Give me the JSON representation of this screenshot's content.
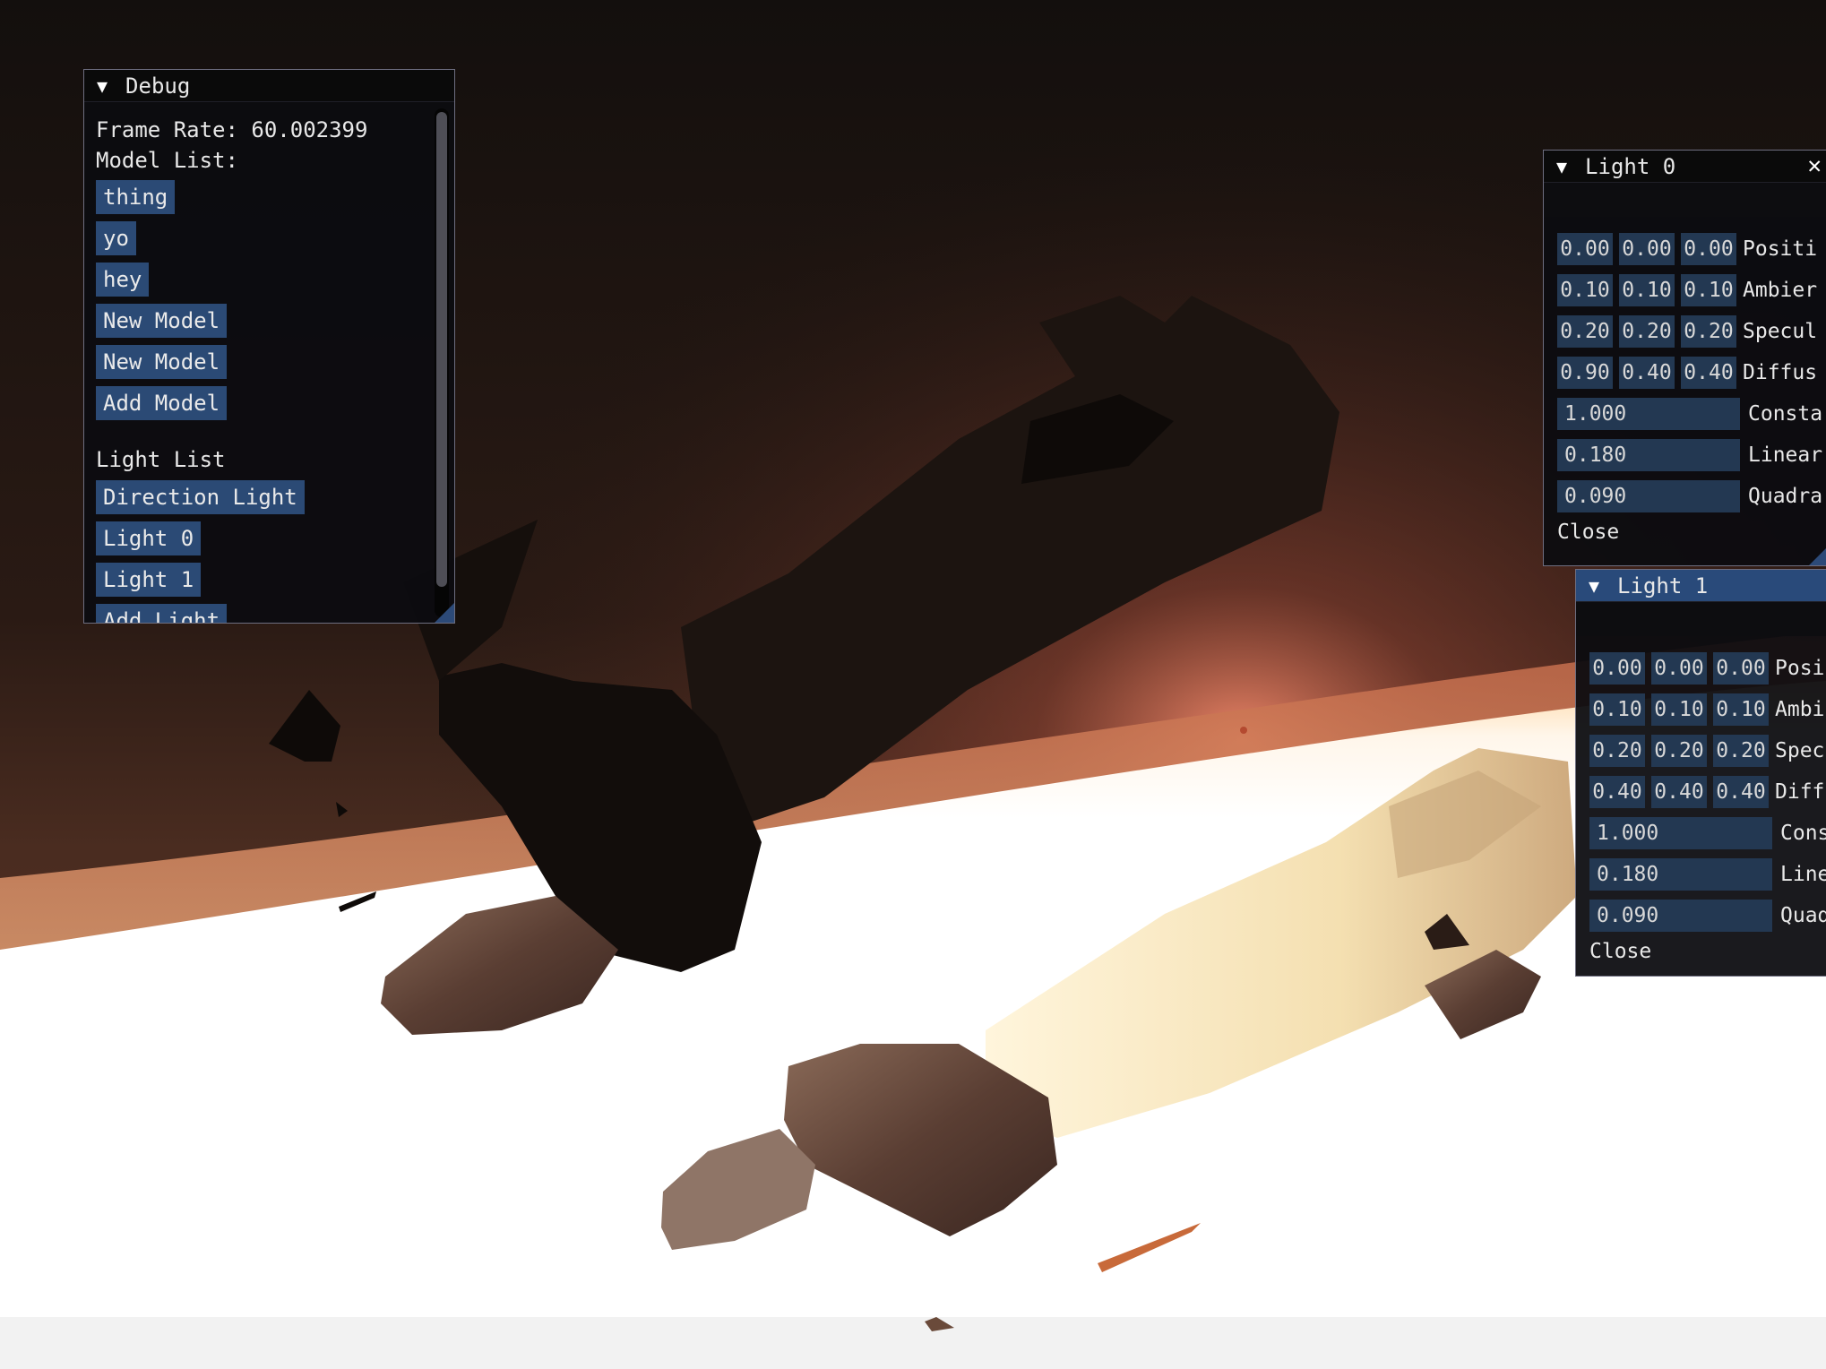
{
  "debug": {
    "title": "Debug",
    "frame_rate": "Frame Rate: 60.002399",
    "model_list_label": "Model List:",
    "models": [
      "thing",
      "yo",
      "hey",
      "New Model",
      "New Model",
      "Add Model"
    ],
    "light_list_label": "Light List",
    "lights": [
      "Direction Light",
      "Light 0",
      "Light 1",
      "Add Light"
    ]
  },
  "light0": {
    "title": "Light 0",
    "close_symbol": "✕",
    "rows": [
      {
        "values": [
          "0.00",
          "0.00",
          "0.00"
        ],
        "label": "Positi"
      },
      {
        "values": [
          "0.10",
          "0.10",
          "0.10"
        ],
        "label": "Ambier"
      },
      {
        "values": [
          "0.20",
          "0.20",
          "0.20"
        ],
        "label": "Specul"
      },
      {
        "values": [
          "0.90",
          "0.40",
          "0.40"
        ],
        "label": "Diffus"
      }
    ],
    "scalars": [
      {
        "value": "1.000",
        "label": "Consta"
      },
      {
        "value": "0.180",
        "label": "Linear"
      },
      {
        "value": "0.090",
        "label": "Quadra"
      }
    ],
    "close_label": "Close"
  },
  "light1": {
    "title": "Light 1",
    "rows": [
      {
        "values": [
          "0.00",
          "0.00",
          "0.00"
        ],
        "label": "Posi"
      },
      {
        "values": [
          "0.10",
          "0.10",
          "0.10"
        ],
        "label": "Ambi"
      },
      {
        "values": [
          "0.20",
          "0.20",
          "0.20"
        ],
        "label": "Spec"
      },
      {
        "values": [
          "0.40",
          "0.40",
          "0.40"
        ],
        "label": "Diff"
      }
    ],
    "scalars": [
      {
        "value": "1.000",
        "label": "Cons"
      },
      {
        "value": "0.180",
        "label": "Line"
      },
      {
        "value": "0.090",
        "label": "Quad"
      }
    ],
    "close_label": "Close"
  },
  "colors": {
    "window_bg": "#0c0c10",
    "button": "#2b4a75",
    "input": "#233852",
    "title_active": "#294a7a"
  }
}
